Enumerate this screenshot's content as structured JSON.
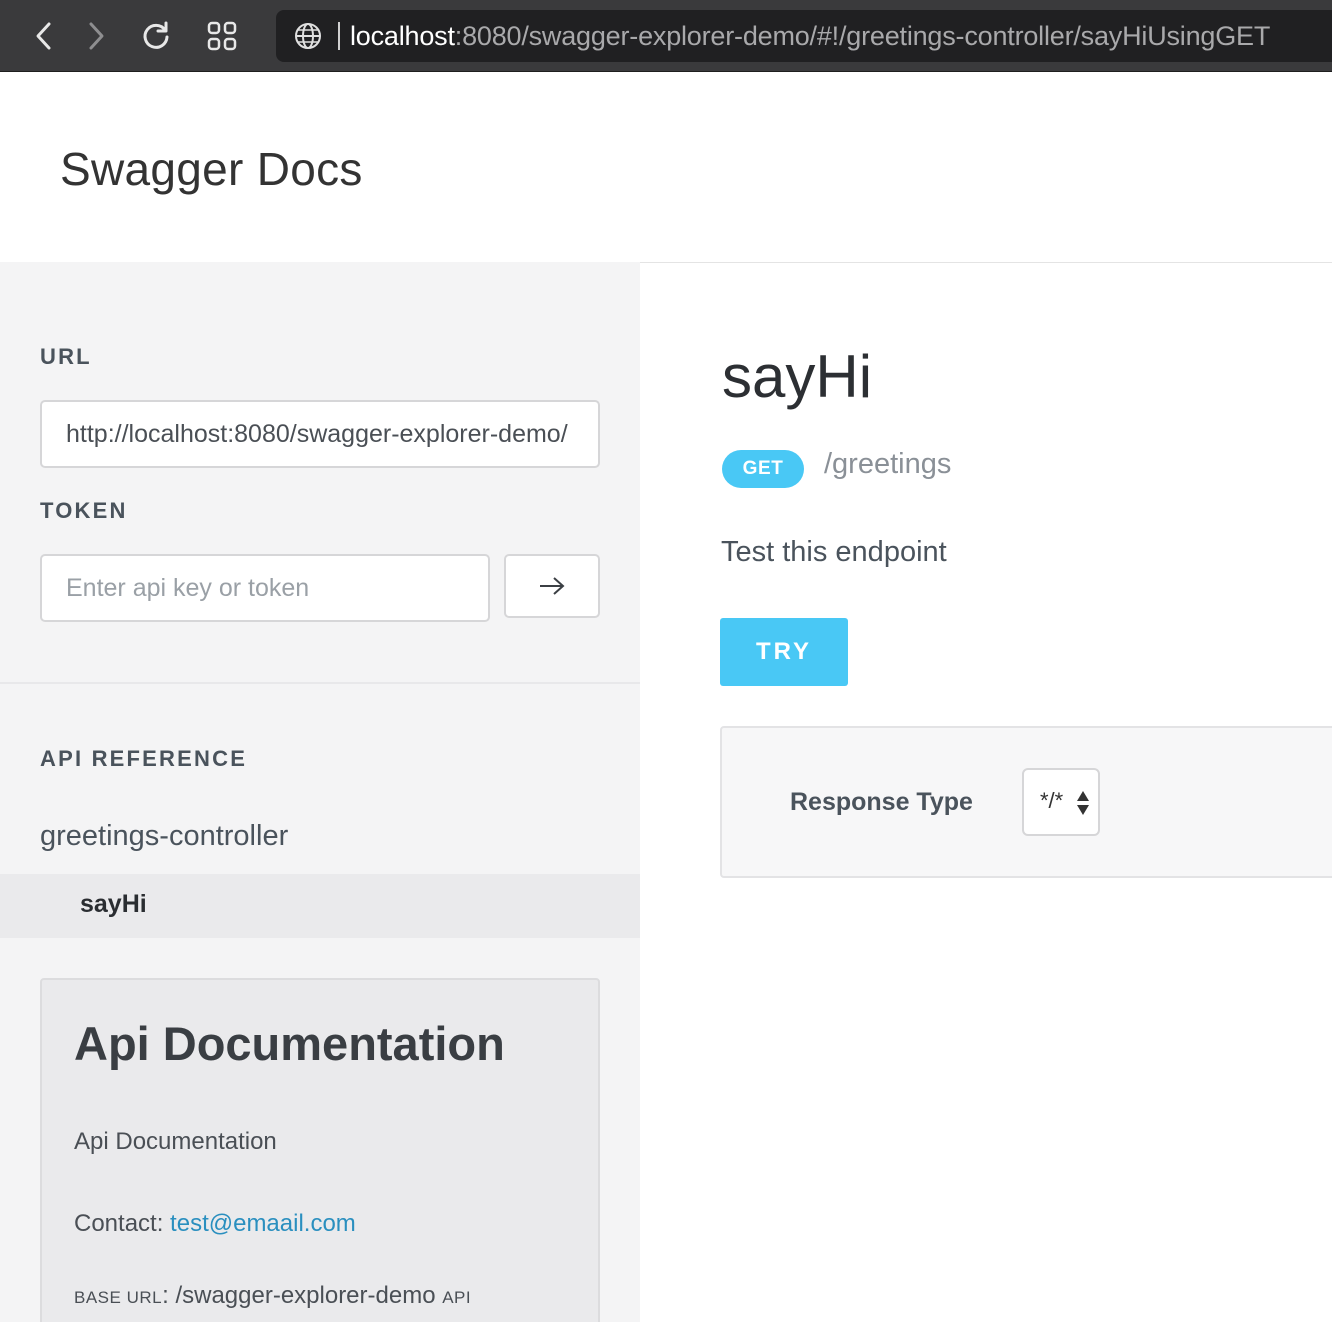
{
  "browser": {
    "url_host": "localhost",
    "url_rest": ":8080/swagger-explorer-demo/#!/greetings-controller/sayHiUsingGET"
  },
  "header": {
    "title": "Swagger Docs"
  },
  "sidebar": {
    "url_label": "URL",
    "url_value": "http://localhost:8080/swagger-explorer-demo/",
    "token_label": "TOKEN",
    "token_placeholder": "Enter api key or token",
    "api_reference_label": "API REFERENCE",
    "controllers": [
      {
        "name": "greetings-controller",
        "endpoints": [
          {
            "label": "sayHi",
            "selected": true
          }
        ]
      }
    ],
    "doc_card": {
      "title": "Api Documentation",
      "description": "Api Documentation",
      "contact_label": "Contact: ",
      "contact_email": "test@emaail.com",
      "base_url_label": "BASE URL",
      "base_url_sep": ": ",
      "base_url_value": "/swagger-explorer-demo",
      "api_suffix": "API"
    }
  },
  "main": {
    "operation_title": "sayHi",
    "method": "GET",
    "path": "/greetings",
    "test_label": "Test this endpoint",
    "try_label": "TRY",
    "response_type_label": "Response Type",
    "response_type_value": "*/*"
  },
  "colors": {
    "accent": "#49c8f5",
    "link": "#2a8fbf",
    "sidebar_bg": "#f4f4f5"
  }
}
